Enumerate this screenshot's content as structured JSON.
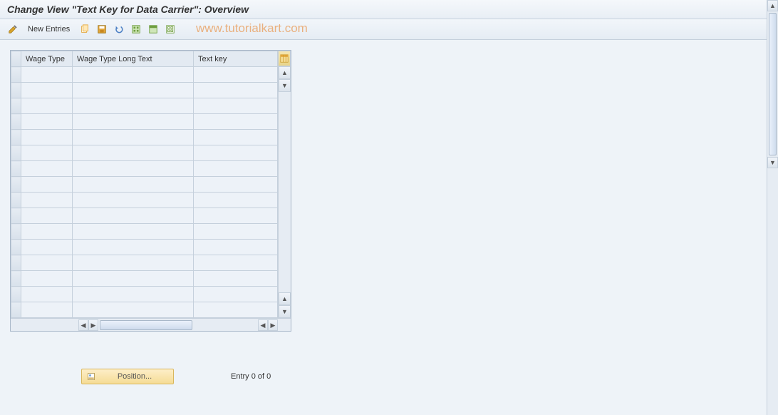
{
  "title": "Change View \"Text Key for Data Carrier\": Overview",
  "watermark": "www.tutorialkart.com",
  "toolbar": {
    "new_entries_label": "New Entries",
    "icons": {
      "toggle": "toggle-change-icon",
      "copy": "copy-icon",
      "save": "save-icon",
      "undo": "undo-icon",
      "select_all": "select-all-icon",
      "deselect": "deselect-icon",
      "config": "config-icon"
    }
  },
  "table": {
    "columns": [
      "Wage Type",
      "Wage Type Long Text",
      "Text key"
    ],
    "rows": [
      [
        "",
        "",
        ""
      ],
      [
        "",
        "",
        ""
      ],
      [
        "",
        "",
        ""
      ],
      [
        "",
        "",
        ""
      ],
      [
        "",
        "",
        ""
      ],
      [
        "",
        "",
        ""
      ],
      [
        "",
        "",
        ""
      ],
      [
        "",
        "",
        ""
      ],
      [
        "",
        "",
        ""
      ],
      [
        "",
        "",
        ""
      ],
      [
        "",
        "",
        ""
      ],
      [
        "",
        "",
        ""
      ],
      [
        "",
        "",
        ""
      ],
      [
        "",
        "",
        ""
      ],
      [
        "",
        "",
        ""
      ],
      [
        "",
        "",
        ""
      ]
    ]
  },
  "footer": {
    "position_label": "Position...",
    "entry_text": "Entry 0 of 0"
  }
}
